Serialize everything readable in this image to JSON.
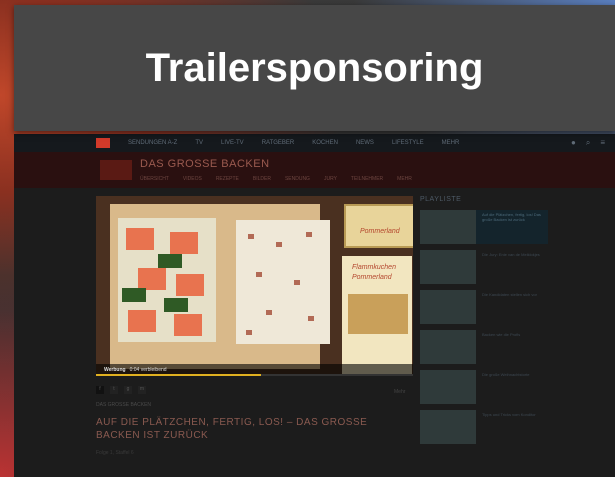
{
  "banner": {
    "title": "Trailersponsoring"
  },
  "topnav": {
    "items": [
      "SENDUNGEN A-Z",
      "TV",
      "LIVE-TV",
      "RATGEBER",
      "KOCHEN",
      "NEWS",
      "LIFESTYLE",
      "MEHR"
    ],
    "icons": [
      "user-icon",
      "search-icon",
      "menu-icon"
    ]
  },
  "show": {
    "title": "DAS GROSSE BACKEN",
    "tabs": [
      "ÜBERSICHT",
      "VIDEOS",
      "REZEPTE",
      "BILDER",
      "SENDUNG",
      "JURY",
      "TEILNEHMER",
      "MEHR"
    ]
  },
  "video": {
    "ad_label": "Werbung",
    "ad_time": "0:04 verbleibend",
    "progress": 0.52,
    "product_brand": "Pommerland",
    "product_label": "Flammkuchen"
  },
  "share": {
    "buttons": [
      "f",
      "t",
      "g",
      "m"
    ]
  },
  "article": {
    "category": "DAS GROSSE BACKEN",
    "headline": "AUF DIE PLÄTZCHEN, FERTIG, LOS! – DAS GROSSE BACKEN IST ZURÜCK",
    "meta": "Folge 1, Staffel 6",
    "more": "Mehr"
  },
  "playlist": {
    "title": "PLAYLISTE",
    "items": [
      {
        "text": "Auf die Plätzchen, fertig, los! Das große Backen ist zurück",
        "active": true
      },
      {
        "text": "Die Jury: Enie van de Meiklokjes",
        "active": false
      },
      {
        "text": "Die Kandidaten stellen sich vor",
        "active": false
      },
      {
        "text": "Backen wie die Profis",
        "active": false
      },
      {
        "text": "Die große Weihnachtstorte",
        "active": false
      },
      {
        "text": "Tipps und Tricks vom Konditor",
        "active": false
      }
    ]
  }
}
